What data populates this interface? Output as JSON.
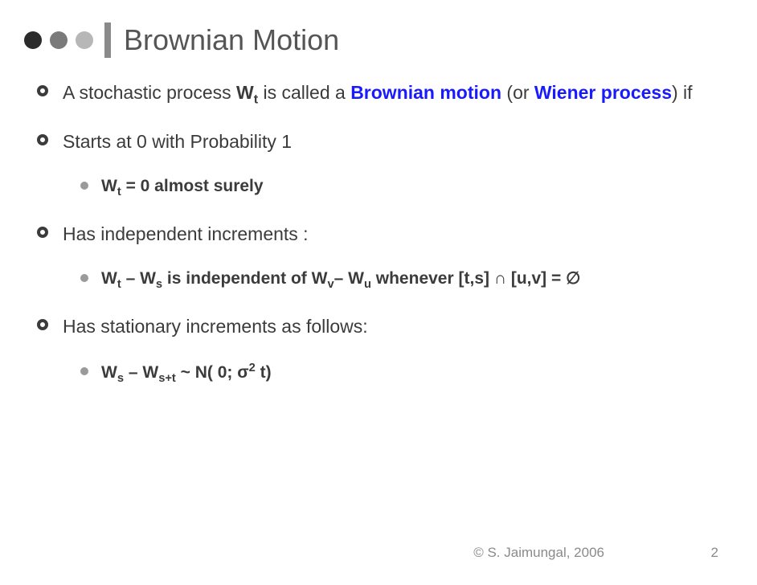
{
  "title": "Brownian Motion",
  "bullets": {
    "b1_pre": "A stochastic process ",
    "b1_wt": "W",
    "b1_wt_sub": "t",
    "b1_mid1": " is called a ",
    "b1_term1": "Brownian motion",
    "b1_mid2": " (or ",
    "b1_term2": "Wiener process",
    "b1_post": ") if",
    "b2": "Starts at 0 with Probability 1",
    "b2a_wt": "W",
    "b2a_wt_sub": "t",
    "b2a_rest": " = 0 almost surely",
    "b3": "Has independent increments :",
    "b3a_w1": "W",
    "b3a_w1s": "t",
    "b3a_m1": " – ",
    "b3a_w2": "W",
    "b3a_w2s": "s",
    "b3a_m2": " is independent of ",
    "b3a_w3": "W",
    "b3a_w3s": "v",
    "b3a_m3": "– ",
    "b3a_w4": "W",
    "b3a_w4s": "u",
    "b3a_m4": " whenever ",
    "b3a_sets": "[t,s] ∩ [u,v] = ∅",
    "b4": "Has stationary increments as follows:",
    "b4a_w1": "W",
    "b4a_w1s": "s",
    "b4a_m1": " – ",
    "b4a_w2": "W",
    "b4a_w2s": "s+t",
    "b4a_m2": " ~ N( 0; σ",
    "b4a_sup": "2",
    "b4a_m3": " t)"
  },
  "footer": {
    "copyright": "© S. Jaimungal, 2006",
    "page": "2"
  }
}
